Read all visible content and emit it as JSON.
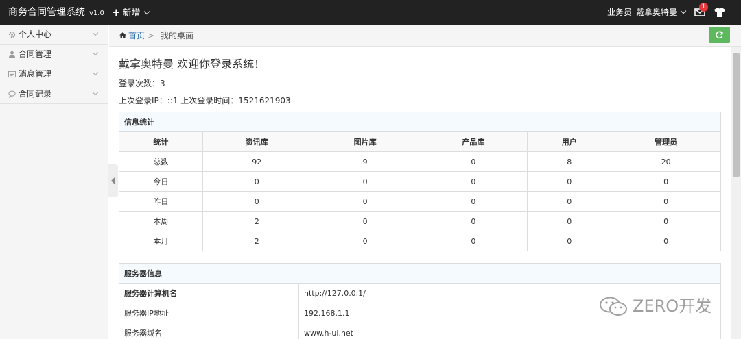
{
  "app": {
    "title": "商务合同管理系统",
    "version": "v1.0"
  },
  "topbar": {
    "add_label": "新增",
    "role": "业务员",
    "username": "戴拿奥特曼",
    "msg_count": "1"
  },
  "sidebar": {
    "items": [
      {
        "label": "个人中心",
        "icon": "gear-icon"
      },
      {
        "label": "合同管理",
        "icon": "user-icon"
      },
      {
        "label": "消息管理",
        "icon": "message-icon"
      },
      {
        "label": "合同记录",
        "icon": "comment-icon"
      }
    ]
  },
  "breadcrumb": {
    "home": "首页",
    "sep": ">",
    "current": "我的桌面"
  },
  "main": {
    "welcome": "戴拿奥特曼 欢迎你登录系统！",
    "login_count": "登录次数：3",
    "last_login": "上次登录IP：::1 上次登录时间：1521621903"
  },
  "stats": {
    "title": "信息统计",
    "headers": [
      "统计",
      "资讯库",
      "图片库",
      "产品库",
      "用户",
      "管理员"
    ],
    "rows": [
      [
        "总数",
        "92",
        "9",
        "0",
        "8",
        "20"
      ],
      [
        "今日",
        "0",
        "0",
        "0",
        "0",
        "0"
      ],
      [
        "昨日",
        "0",
        "0",
        "0",
        "0",
        "0"
      ],
      [
        "本周",
        "2",
        "0",
        "0",
        "0",
        "0"
      ],
      [
        "本月",
        "2",
        "0",
        "0",
        "0",
        "0"
      ]
    ]
  },
  "server": {
    "title": "服务器信息",
    "rows": [
      [
        "服务器计算机名",
        "http://127.0.0.1/"
      ],
      [
        "服务器IP地址",
        "192.168.1.1"
      ],
      [
        "服务器域名",
        "www.h-ui.net"
      ]
    ]
  },
  "watermark": "ZERO开发"
}
